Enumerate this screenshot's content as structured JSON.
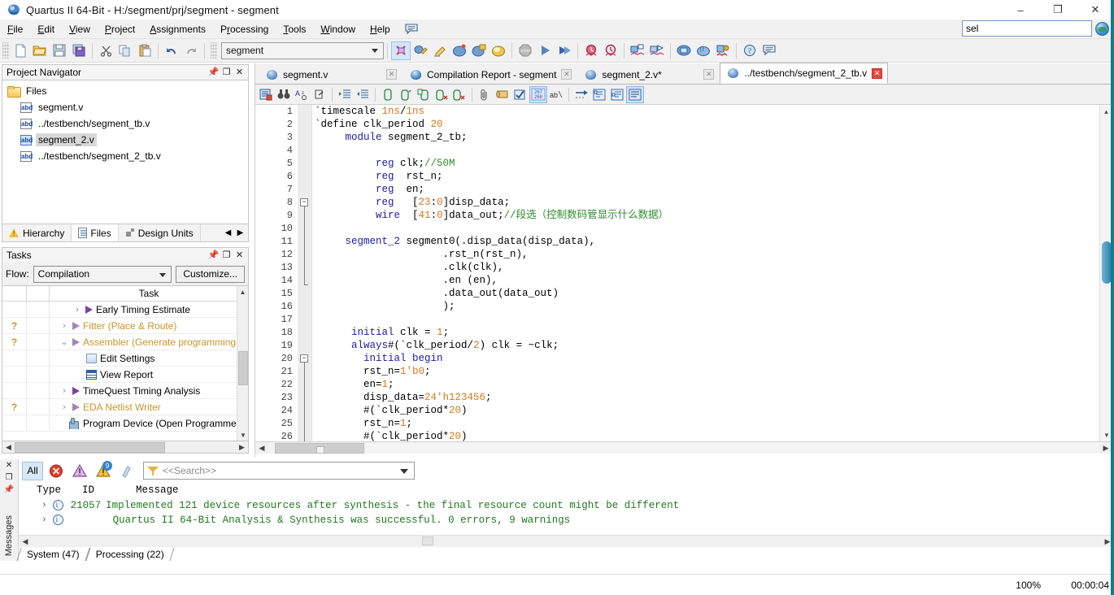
{
  "window": {
    "title": "Quartus II 64-Bit - H:/segment/prj/segment - segment",
    "app_icon": "quartus-icon",
    "minimize": "–",
    "maximize": "❐",
    "close": "✕"
  },
  "menubar": {
    "items": [
      {
        "label": "File",
        "accel": "F"
      },
      {
        "label": "Edit",
        "accel": "E"
      },
      {
        "label": "View",
        "accel": "V"
      },
      {
        "label": "Project",
        "accel": "P"
      },
      {
        "label": "Assignments",
        "accel": "A"
      },
      {
        "label": "Processing",
        "accel": "r"
      },
      {
        "label": "Tools",
        "accel": "T"
      },
      {
        "label": "Window",
        "accel": "W"
      },
      {
        "label": "Help",
        "accel": "H"
      }
    ],
    "bubble_icon": "message-bubble-icon"
  },
  "top_search": {
    "value": "sel",
    "placeholder": "",
    "globe_icon": "globe-search-icon"
  },
  "toolbar": {
    "project_combo_value": "segment",
    "buttons": [
      {
        "name": "new-file-button",
        "icon": "new-document-icon"
      },
      {
        "name": "open-file-button",
        "icon": "open-folder-icon"
      },
      {
        "name": "save-file-button",
        "icon": "floppy-save-icon"
      },
      {
        "name": "save-all-button",
        "icon": "save-all-icon"
      },
      {
        "name": "cut-button",
        "icon": "scissors-icon"
      },
      {
        "name": "copy-button",
        "icon": "copy-icon"
      },
      {
        "name": "paste-button",
        "icon": "paste-icon"
      },
      {
        "name": "undo-button",
        "icon": "undo-arrow-icon"
      },
      {
        "name": "redo-button",
        "icon": "redo-arrow-icon"
      },
      {
        "name": "settings-button",
        "icon": "settings-wrench-icon"
      },
      {
        "name": "assignment-editor-button",
        "icon": "assignment-editor-icon"
      },
      {
        "name": "pin-planner-button",
        "icon": "pencil-icon"
      },
      {
        "name": "compile-design-button",
        "icon": "compile-chip-icon"
      },
      {
        "name": "analysis-synthesis-button",
        "icon": "analysis-chip-icon"
      },
      {
        "name": "fitter-button",
        "icon": "fitter-chip-icon"
      },
      {
        "name": "stop-button",
        "icon": "stop-sign-icon"
      },
      {
        "name": "start-compilation-button",
        "icon": "play-icon"
      },
      {
        "name": "start-analysis-button",
        "icon": "fast-forward-icon"
      },
      {
        "name": "timequest-button",
        "icon": "clock-red-icon"
      },
      {
        "name": "timing-analyzer-button",
        "icon": "stopwatch-icon"
      },
      {
        "name": "netlist-viewer-button",
        "icon": "rtl-viewer-icon"
      },
      {
        "name": "tech-map-viewer-button",
        "icon": "tech-map-viewer-icon"
      },
      {
        "name": "programmer-button",
        "icon": "programmer-chip-icon"
      },
      {
        "name": "open-programmer-button",
        "icon": "hand-chip-icon"
      },
      {
        "name": "signaltap-button",
        "icon": "signaltap-icon"
      },
      {
        "name": "help-button",
        "icon": "help-question-icon"
      },
      {
        "name": "messages-button",
        "icon": "message-bubble-icon"
      }
    ]
  },
  "project_navigator": {
    "title": "Project Navigator",
    "pin_icon": "pin-icon",
    "restore_icon": "restore-icon",
    "close_icon": "close-icon",
    "root": {
      "label": "Files",
      "icon": "folder-icon"
    },
    "files": [
      {
        "label": "segment.v",
        "icon": "verilog-file-icon",
        "selected": false
      },
      {
        "label": "../testbench/segment_tb.v",
        "icon": "verilog-file-icon",
        "selected": false
      },
      {
        "label": "segment_2.v",
        "icon": "verilog-file-icon",
        "selected": true
      },
      {
        "label": "../testbench/segment_2_tb.v",
        "icon": "verilog-file-icon",
        "selected": false
      }
    ],
    "tabs": [
      {
        "label": "Hierarchy",
        "icon": "hierarchy-warning-icon",
        "active": false
      },
      {
        "label": "Files",
        "icon": "files-doc-icon",
        "active": true
      },
      {
        "label": "Design Units",
        "icon": "design-units-icon",
        "active": false
      }
    ],
    "nav_prev": "◀",
    "nav_next": "▶"
  },
  "tasks": {
    "title": "Tasks",
    "flow_label": "Flow:",
    "flow_value": "Compilation",
    "customize_label": "Customize...",
    "column_header": "Task",
    "rows": [
      {
        "status": "",
        "chevron": "›",
        "icon": "play-icon",
        "label": "Early Timing Estimate",
        "dim": false,
        "indent": 2
      },
      {
        "status": "?",
        "chevron": "›",
        "icon": "play-icon",
        "label": "Fitter (Place & Route)",
        "dim": true,
        "indent": 1
      },
      {
        "status": "?",
        "chevron": "⌄",
        "icon": "play-icon",
        "label": "Assembler (Generate programming file",
        "dim": true,
        "indent": 1
      },
      {
        "status": "",
        "chevron": "",
        "icon": "edit-settings-icon",
        "label": "Edit Settings",
        "dim": false,
        "indent": 3
      },
      {
        "status": "",
        "chevron": "",
        "icon": "view-report-icon",
        "label": "View Report",
        "dim": false,
        "indent": 3
      },
      {
        "status": "",
        "chevron": "›",
        "icon": "play-icon",
        "label": "TimeQuest Timing Analysis",
        "dim": false,
        "indent": 1
      },
      {
        "status": "?",
        "chevron": "›",
        "icon": "play-icon",
        "label": "EDA Netlist Writer",
        "dim": true,
        "indent": 1
      },
      {
        "status": "",
        "chevron": "",
        "icon": "hand-program-icon",
        "label": "Program Device (Open Programmer)",
        "dim": false,
        "indent": 1
      }
    ]
  },
  "editor": {
    "tabs": [
      {
        "label": "segment.v",
        "icon": "quartus-file-icon",
        "active": false,
        "close": "✕",
        "modified": false
      },
      {
        "label": "Compilation Report - segment",
        "icon": "compilation-report-icon",
        "active": false,
        "close": "✕",
        "modified": false
      },
      {
        "label": "segment_2.v*",
        "icon": "quartus-file-icon",
        "active": false,
        "close": "✕",
        "modified": true
      },
      {
        "label": "../testbench/segment_2_tb.v",
        "icon": "quartus-file-icon",
        "active": true,
        "close": "✕",
        "modified": false
      }
    ],
    "toolbar_buttons": [
      {
        "name": "insert-template-button",
        "icon": "insert-template-icon"
      },
      {
        "name": "find-button",
        "icon": "binoculars-find-icon"
      },
      {
        "name": "replace-button",
        "icon": "find-replace-icon"
      },
      {
        "name": "goto-button",
        "icon": "goto-line-icon"
      },
      {
        "name": "increase-indent-button",
        "icon": "increase-indent-icon"
      },
      {
        "name": "decrease-indent-button",
        "icon": "decrease-indent-icon"
      },
      {
        "name": "comment-button",
        "icon": "comment-lines-icon"
      },
      {
        "name": "uncomment-button",
        "icon": "uncomment-lines-icon"
      },
      {
        "name": "bookmark-toggle-button",
        "icon": "bookmark-toggle-icon"
      },
      {
        "name": "bookmark-next-button",
        "icon": "bookmark-next-icon"
      },
      {
        "name": "bookmark-clear-button",
        "icon": "bookmark-clear-icon"
      },
      {
        "name": "attach-button",
        "icon": "paperclip-icon"
      },
      {
        "name": "file-list-button",
        "icon": "scroll-icon"
      },
      {
        "name": "check-syntax-button",
        "icon": "check-syntax-icon"
      },
      {
        "name": "line-numbers-button",
        "icon": "line-numbers-icon"
      },
      {
        "name": "word-wrap-button",
        "icon": "word-wrap-icon"
      },
      {
        "name": "goto-next-button",
        "icon": "arrow-right-dotted-icon"
      },
      {
        "name": "collapse-all-button",
        "icon": "collapse-all-icon"
      },
      {
        "name": "expand-all-button",
        "icon": "expand-all-icon"
      },
      {
        "name": "show-all-button",
        "icon": "show-all-icon"
      }
    ],
    "first_line": 1,
    "lines": [
      {
        "n": 1,
        "tokens": [
          {
            "t": "`timescale ",
            "c": "plain"
          },
          {
            "t": "1ns",
            "c": "num"
          },
          {
            "t": "/",
            "c": "plain"
          },
          {
            "t": "1ns",
            "c": "num"
          }
        ]
      },
      {
        "n": 2,
        "tokens": [
          {
            "t": "`define clk_period ",
            "c": "plain"
          },
          {
            "t": "20",
            "c": "num"
          }
        ]
      },
      {
        "n": 3,
        "tokens": [
          {
            "t": "     ",
            "c": "plain"
          },
          {
            "t": "module",
            "c": "kw"
          },
          {
            "t": " segment_2_tb;",
            "c": "plain"
          }
        ]
      },
      {
        "n": 4,
        "tokens": []
      },
      {
        "n": 5,
        "tokens": [
          {
            "t": "          ",
            "c": "plain"
          },
          {
            "t": "reg",
            "c": "kw"
          },
          {
            "t": " clk;",
            "c": "plain"
          },
          {
            "t": "//50M",
            "c": "cmt"
          }
        ]
      },
      {
        "n": 6,
        "tokens": [
          {
            "t": "          ",
            "c": "plain"
          },
          {
            "t": "reg",
            "c": "kw"
          },
          {
            "t": "  rst_n;",
            "c": "plain"
          }
        ]
      },
      {
        "n": 7,
        "tokens": [
          {
            "t": "          ",
            "c": "plain"
          },
          {
            "t": "reg",
            "c": "kw"
          },
          {
            "t": "  en;",
            "c": "plain"
          }
        ]
      },
      {
        "n": 8,
        "tokens": [
          {
            "t": "          ",
            "c": "plain"
          },
          {
            "t": "reg",
            "c": "kw"
          },
          {
            "t": "   [",
            "c": "plain"
          },
          {
            "t": "23",
            "c": "num"
          },
          {
            "t": ":",
            "c": "plain"
          },
          {
            "t": "0",
            "c": "num"
          },
          {
            "t": "]disp_data;",
            "c": "plain"
          }
        ]
      },
      {
        "n": 9,
        "tokens": [
          {
            "t": "          ",
            "c": "plain"
          },
          {
            "t": "wire",
            "c": "kw"
          },
          {
            "t": "  [",
            "c": "plain"
          },
          {
            "t": "41",
            "c": "num"
          },
          {
            "t": ":",
            "c": "plain"
          },
          {
            "t": "0",
            "c": "num"
          },
          {
            "t": "]data_out;",
            "c": "plain"
          },
          {
            "t": "//段选（控制数码管显示什么数据）",
            "c": "cmt"
          }
        ]
      },
      {
        "n": 10,
        "tokens": []
      },
      {
        "n": 11,
        "tokens": [
          {
            "t": "     ",
            "c": "plain"
          },
          {
            "t": "segment_2",
            "c": "kw"
          },
          {
            "t": " segment0(.disp_data(disp_data),",
            "c": "plain"
          }
        ]
      },
      {
        "n": 12,
        "tokens": [
          {
            "t": "                     .rst_n(rst_n),",
            "c": "plain"
          }
        ]
      },
      {
        "n": 13,
        "tokens": [
          {
            "t": "                     .clk(clk),",
            "c": "plain"
          }
        ]
      },
      {
        "n": 14,
        "tokens": [
          {
            "t": "                     .en (en),",
            "c": "plain"
          }
        ]
      },
      {
        "n": 15,
        "tokens": [
          {
            "t": "                     .data_out(data_out)",
            "c": "plain"
          }
        ]
      },
      {
        "n": 16,
        "tokens": [
          {
            "t": "                     );",
            "c": "plain"
          }
        ]
      },
      {
        "n": 17,
        "tokens": []
      },
      {
        "n": 18,
        "tokens": [
          {
            "t": "      ",
            "c": "plain"
          },
          {
            "t": "initial",
            "c": "kw"
          },
          {
            "t": " clk = ",
            "c": "plain"
          },
          {
            "t": "1",
            "c": "num"
          },
          {
            "t": ";",
            "c": "plain"
          }
        ]
      },
      {
        "n": 19,
        "tokens": [
          {
            "t": "      ",
            "c": "plain"
          },
          {
            "t": "always",
            "c": "kw"
          },
          {
            "t": "#(`clk_period/",
            "c": "plain"
          },
          {
            "t": "2",
            "c": "num"
          },
          {
            "t": ") clk = ~clk;",
            "c": "plain"
          }
        ]
      },
      {
        "n": 20,
        "tokens": [
          {
            "t": "        ",
            "c": "plain"
          },
          {
            "t": "initial",
            "c": "kw"
          },
          {
            "t": " ",
            "c": "plain"
          },
          {
            "t": "begin",
            "c": "kw"
          }
        ]
      },
      {
        "n": 21,
        "tokens": [
          {
            "t": "        rst_n=",
            "c": "plain"
          },
          {
            "t": "1'b0",
            "c": "num"
          },
          {
            "t": ";",
            "c": "plain"
          }
        ]
      },
      {
        "n": 22,
        "tokens": [
          {
            "t": "        en=",
            "c": "plain"
          },
          {
            "t": "1",
            "c": "num"
          },
          {
            "t": ";",
            "c": "plain"
          }
        ]
      },
      {
        "n": 23,
        "tokens": [
          {
            "t": "        disp_data=",
            "c": "plain"
          },
          {
            "t": "24'h123456",
            "c": "num"
          },
          {
            "t": ";",
            "c": "plain"
          }
        ]
      },
      {
        "n": 24,
        "tokens": [
          {
            "t": "        #(`clk_period*",
            "c": "plain"
          },
          {
            "t": "20",
            "c": "num"
          },
          {
            "t": ")",
            "c": "plain"
          }
        ]
      },
      {
        "n": 25,
        "tokens": [
          {
            "t": "        rst_n=",
            "c": "plain"
          },
          {
            "t": "1",
            "c": "num"
          },
          {
            "t": ";",
            "c": "plain"
          }
        ]
      },
      {
        "n": 26,
        "tokens": [
          {
            "t": "        #(`clk_period*",
            "c": "plain"
          },
          {
            "t": "20",
            "c": "num"
          },
          {
            "t": ")",
            "c": "plain"
          }
        ]
      }
    ]
  },
  "messages": {
    "panel_label": "Messages",
    "close_icon": "close-icon",
    "restore_icon": "restore-icon",
    "pin_icon": "pin-icon",
    "filters": [
      {
        "name": "filter-all-button",
        "label": "All",
        "selected": true
      },
      {
        "name": "filter-error-button",
        "icon": "error-circle-icon",
        "badge": ""
      },
      {
        "name": "filter-critical-warning-button",
        "icon": "critical-warning-icon",
        "badge": ""
      },
      {
        "name": "filter-warning-button",
        "icon": "warning-triangle-icon",
        "badge": "9"
      },
      {
        "name": "filter-info-button",
        "icon": "info-flag-icon",
        "badge": ""
      }
    ],
    "search_placeholder": "<<Search>>",
    "columns": [
      "Type",
      "ID",
      "Message"
    ],
    "rows": [
      {
        "expander": "›",
        "icon": "info-icon",
        "id": "21057",
        "text": "Implemented 121 device resources after synthesis - the final resource count might be different"
      },
      {
        "expander": "›",
        "icon": "info-icon",
        "id": "",
        "text": "Quartus II 64-Bit Analysis & Synthesis was successful. 0 errors, 9 warnings"
      }
    ],
    "tabs": [
      {
        "label": "System (47)",
        "active": false
      },
      {
        "label": "Processing (22)",
        "active": false
      }
    ]
  },
  "statusbar": {
    "zoom": "100%",
    "elapsed_time": "00:00:04"
  },
  "colors": {
    "keyword": "#1a1aa8",
    "number": "#d4781e",
    "comment": "#2e8b2e",
    "task_dim": "#c8952c",
    "accent_teal": "#0b7d8c",
    "selection": "#d8d8d8"
  }
}
